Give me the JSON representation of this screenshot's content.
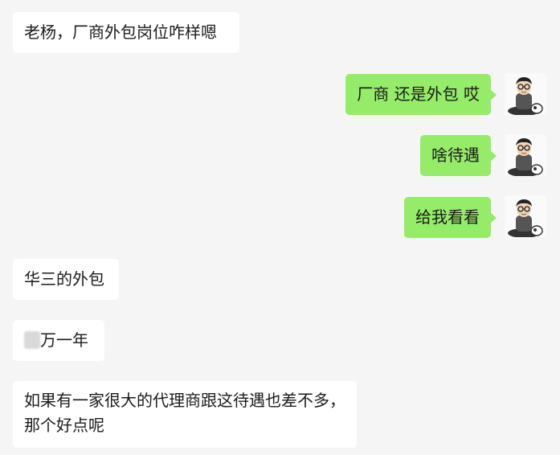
{
  "messages": [
    {
      "side": "in",
      "text": "老杨，厂商外包岗位咋样嗯"
    },
    {
      "side": "out",
      "text": "厂商 还是外包 哎"
    },
    {
      "side": "out",
      "text": "啥待遇"
    },
    {
      "side": "out",
      "text": "给我看看"
    },
    {
      "side": "in",
      "text": "华三的外包"
    },
    {
      "side": "in",
      "text": "万一年"
    },
    {
      "side": "in",
      "text": "如果有一家很大的代理商跟这待遇也差不多，那个好点呢"
    }
  ],
  "avatar_icon": "cartoon-man-with-glasses-avatar",
  "colors": {
    "background": "#f5f5f5",
    "incoming_bubble": "#ffffff",
    "outgoing_bubble": "#95ec69"
  }
}
